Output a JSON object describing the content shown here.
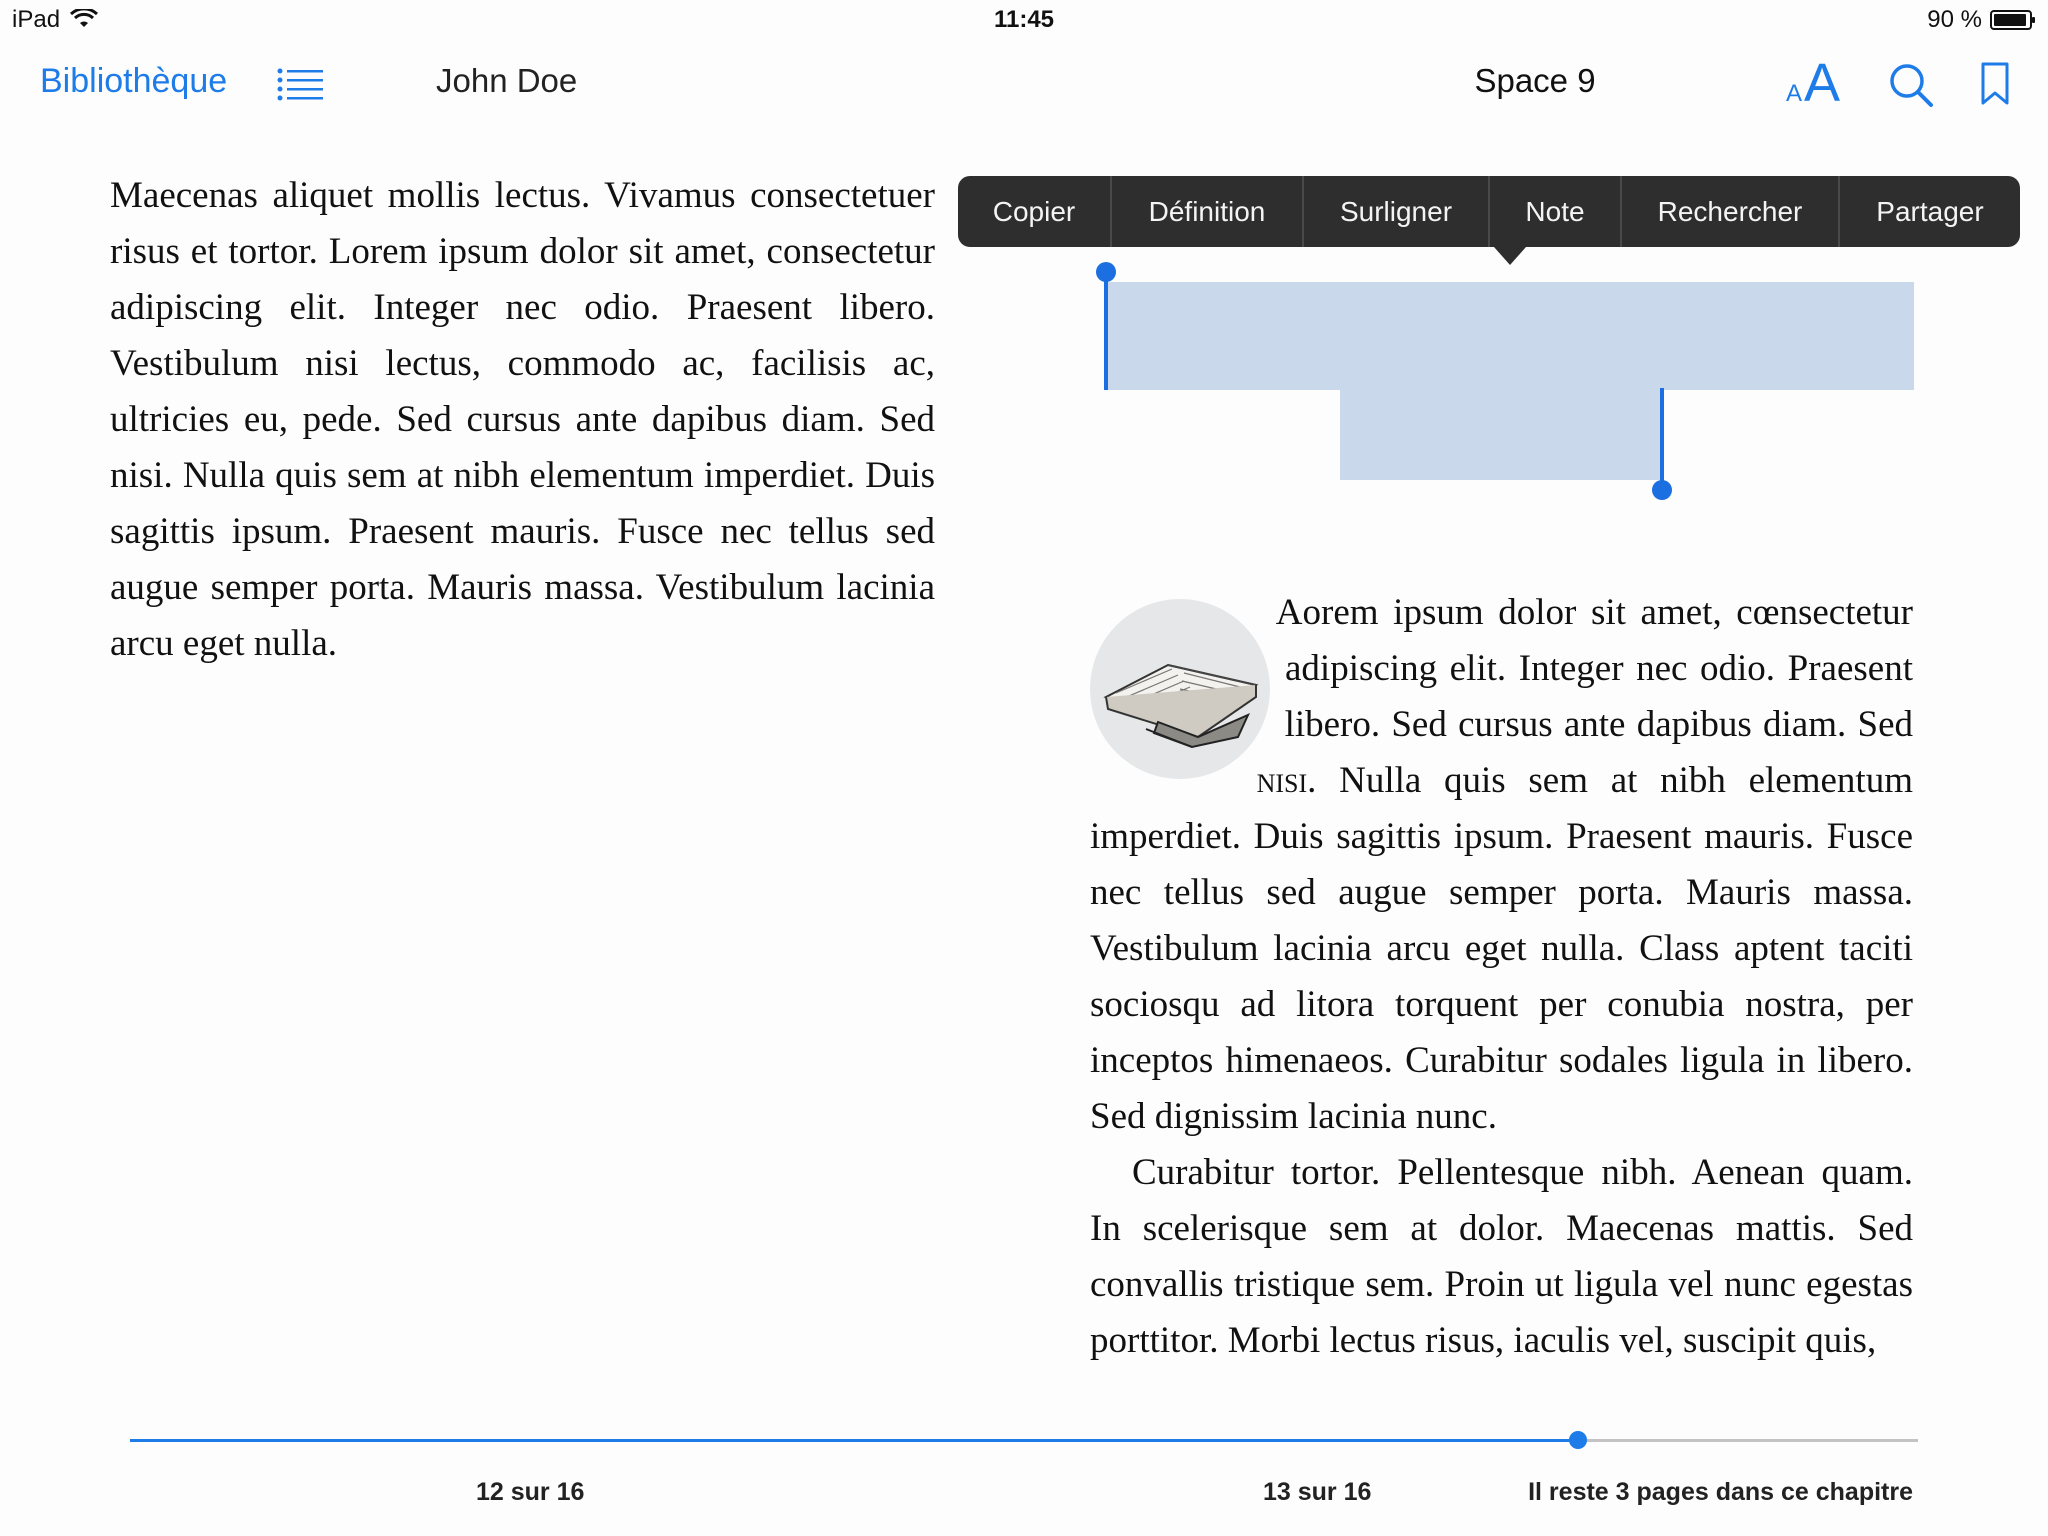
{
  "status_bar": {
    "device": "iPad",
    "time": "11:45",
    "battery": "90 %"
  },
  "nav": {
    "library_label": "Bibliothèque",
    "author": "John Doe",
    "book_title": "Space 9",
    "font_size_label_small": "A",
    "font_size_label_large": "A"
  },
  "icons": {
    "wifi": "wifi-icon",
    "battery": "battery-icon",
    "toc": "list-icon",
    "font_size": "font-size-icon",
    "search": "search-icon",
    "bookmark": "bookmark-icon"
  },
  "edit_menu": {
    "items": [
      "Copier",
      "Définition",
      "Surligner",
      "Note",
      "Rechercher",
      "Partager"
    ]
  },
  "page_left": {
    "text": "Maecenas aliquet mollis lectus. Vivamus consectetuer risus et tortor. Lorem ipsum dolor sit amet, consectetur adipiscing elit. Integer nec odio. Praesent libero. Vestibulum nisi lectus, commodo ac, facilisis ac, ultricies eu, pede. Sed cursus ante dapibus diam. Sed nisi. Nulla quis sem at nibh elementum imperdiet. Duis sagittis ipsum. Praesent mauris. Fusce nec tellus sed augue semper porta. Mauris massa. Vestibulum lacinia arcu eget nulla."
  },
  "page_right": {
    "paragraph1_before": "Aorem ipsum dolor sit amet, cœnsectetur adipiscing elit. Integer nec odio. Praesent libero. Sed cursus ante dapibus diam. Sed ",
    "paragraph1_smallcaps": "nisi",
    "paragraph1_after": ". Nulla quis sem at nibh elementum imperdiet. Duis sagittis ipsum. Praesent mauris. Fusce nec tellus sed augue semper porta. Mauris massa. Vestibulum lacinia arcu eget nulla. Class aptent taciti sociosqu ad litora torquent per conubia nostra, per inceptos himenaeos. Curabitur sodales ligula in libero. Sed dignissim lacinia nunc.",
    "paragraph2": "Curabitur tortor. Pellentesque nibh. Aenean quam. In scelerisque sem at dolor. Maecenas mattis. Sed convallis tristique sem. Proin ut ligula vel nunc egestas porttitor. Morbi lectus risus, iaculis vel, suscipit quis,",
    "image": "open-book-illustration"
  },
  "footer": {
    "left_page": "12 sur 16",
    "right_page": "13 sur 16",
    "remaining": "Il reste 3 pages dans ce chapitre",
    "progress_fraction": 0.81
  },
  "colors": {
    "accent": "#1e7ce8",
    "selection": "#c9d8ea",
    "menu_background": "#2e2e2e"
  }
}
